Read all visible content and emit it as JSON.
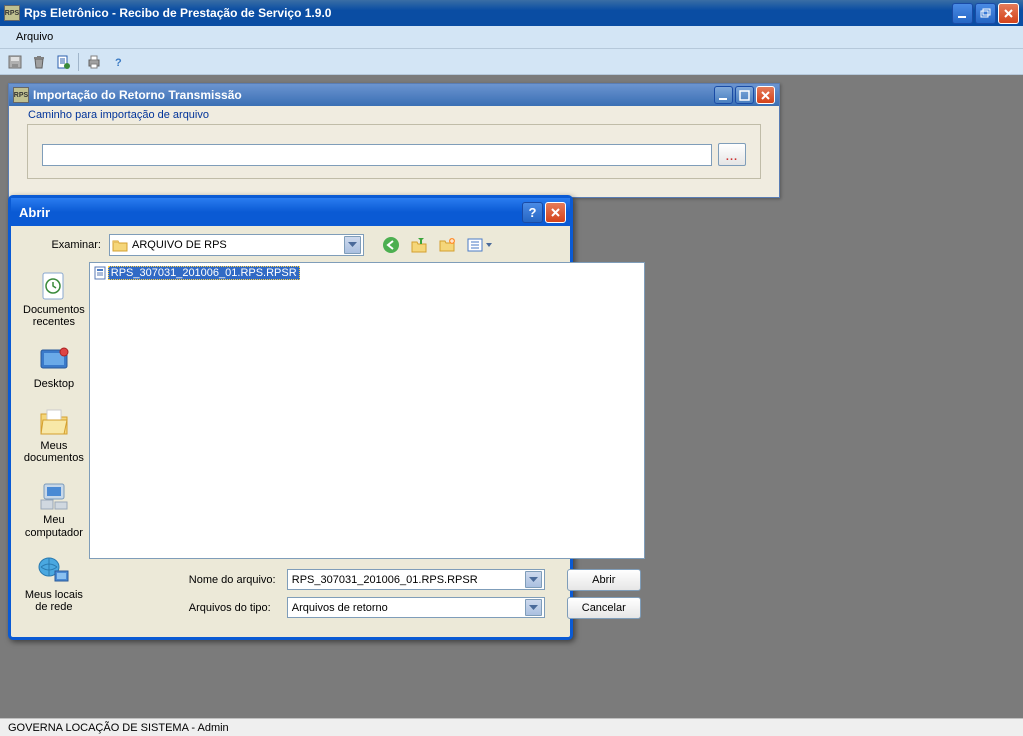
{
  "main": {
    "title": "Rps Eletrônico - Recibo de Prestação de Serviço 1.9.0",
    "app_icon_text": "RPS"
  },
  "menu": {
    "arquivo": "Arquivo"
  },
  "toolbar": {
    "icons": [
      "save",
      "delete",
      "refresh",
      "print",
      "help"
    ]
  },
  "import_window": {
    "title": "Importação do Retorno Transmissão",
    "legend": "Caminho para importação de arquivo",
    "path_value": "",
    "browse_label": "..."
  },
  "open_dialog": {
    "title": "Abrir",
    "look_in_label": "Examinar:",
    "look_in_value": "ARQUIVO DE RPS",
    "places": [
      {
        "key": "recent",
        "label": "Documentos recentes"
      },
      {
        "key": "desktop",
        "label": "Desktop"
      },
      {
        "key": "mydocs",
        "label": "Meus documentos"
      },
      {
        "key": "mycomputer",
        "label": "Meu computador"
      },
      {
        "key": "network",
        "label": "Meus locais de rede"
      }
    ],
    "files": [
      {
        "name": "RPS_307031_201006_01.RPS.RPSR",
        "selected": true
      }
    ],
    "filename_label": "Nome do arquivo:",
    "filename_value": "RPS_307031_201006_01.RPS.RPSR",
    "filetype_label": "Arquivos do tipo:",
    "filetype_value": "Arquivos de retorno",
    "open_button": "Abrir",
    "cancel_button": "Cancelar"
  },
  "statusbar": {
    "text": "GOVERNA LOCAÇÃO DE SISTEMA - Admin"
  }
}
